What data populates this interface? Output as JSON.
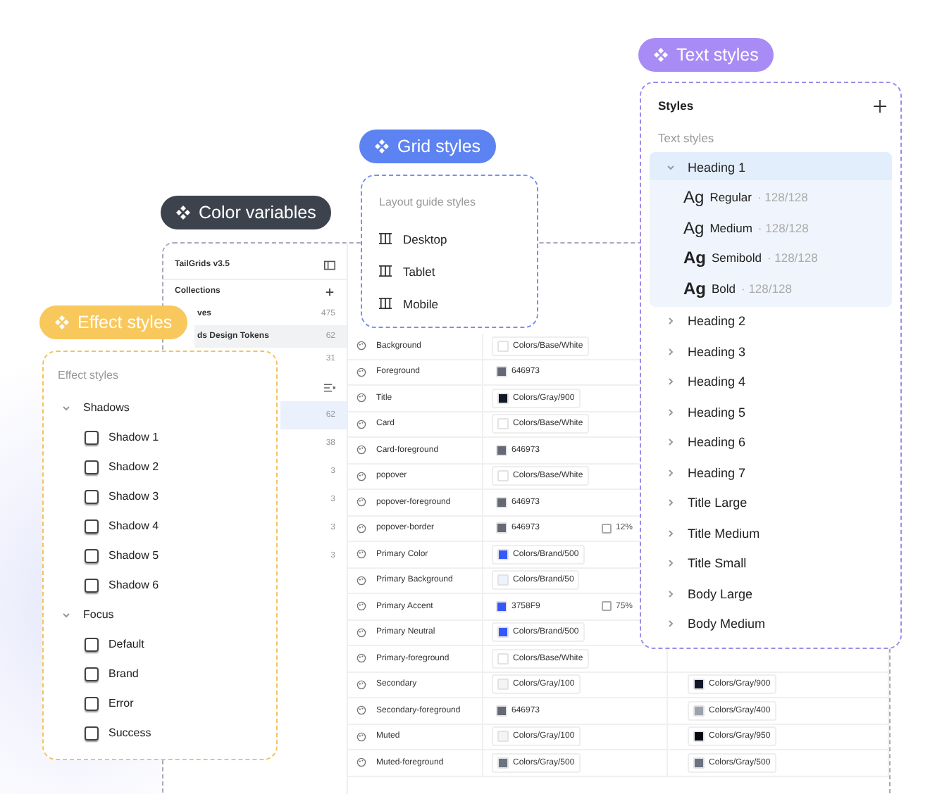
{
  "color_variables": {
    "badge": "Color variables",
    "sidebar": {
      "title": "TailGrids v3.5",
      "collections_label": "Collections",
      "collections": [
        {
          "name": "ves",
          "count": "475",
          "selected": false
        },
        {
          "name": "ds Design Tokens",
          "count": "62",
          "selected": true
        },
        {
          "count": "31",
          "selected": false
        }
      ],
      "groups": [
        {
          "count": "62",
          "selected": true
        },
        {
          "count": "38",
          "selected": false
        },
        {
          "count": "3",
          "selected": false
        },
        {
          "count": "3",
          "selected": false
        },
        {
          "count": "3",
          "selected": false
        },
        {
          "count": "3",
          "selected": false
        }
      ]
    },
    "rows": [
      {
        "name": "Background",
        "value": {
          "text": "Colors/Base/White",
          "kind": "alias",
          "color": "#ffffff"
        }
      },
      {
        "name": "Foreground",
        "value": {
          "text": "646973",
          "kind": "hex",
          "color": "#646973"
        }
      },
      {
        "name": "Title",
        "value": {
          "text": "Colors/Gray/900",
          "kind": "alias",
          "color": "#111827"
        }
      },
      {
        "name": "Card",
        "value": {
          "text": "Colors/Base/White",
          "kind": "alias",
          "color": "#ffffff"
        }
      },
      {
        "name": "Card-foreground",
        "value": {
          "text": "646973",
          "kind": "hex",
          "color": "#646973"
        }
      },
      {
        "name": "popover",
        "value": {
          "text": "Colors/Base/White",
          "kind": "alias",
          "color": "#ffffff"
        }
      },
      {
        "name": "popover-foreground",
        "value": {
          "text": "646973",
          "kind": "hex",
          "color": "#646973"
        }
      },
      {
        "name": "popover-border",
        "value": {
          "text": "646973",
          "kind": "hex",
          "color": "#646973"
        },
        "opacity": "12%"
      },
      {
        "name": "Primary Color",
        "value": {
          "text": "Colors/Brand/500",
          "kind": "alias",
          "color": "#3758f9"
        }
      },
      {
        "name": "Primary Background",
        "value": {
          "text": "Colors/Brand/50",
          "kind": "alias",
          "color": "#eef2ff"
        }
      },
      {
        "name": "Primary Accent",
        "value": {
          "text": "3758F9",
          "kind": "hex",
          "color": "#3758f9"
        },
        "opacity": "75%"
      },
      {
        "name": "Primary Neutral",
        "value": {
          "text": "Colors/Brand/500",
          "kind": "alias",
          "color": "#3758f9"
        }
      },
      {
        "name": "Primary-foreground",
        "value": {
          "text": "Colors/Base/White",
          "kind": "alias",
          "color": "#ffffff"
        }
      },
      {
        "name": "Secondary",
        "value": {
          "text": "Colors/Gray/100",
          "kind": "alias",
          "color": "#f3f4f6"
        },
        "mode_value": {
          "text": "Colors/Gray/900",
          "kind": "alias",
          "color": "#111827"
        }
      },
      {
        "name": "Secondary-foreground",
        "value": {
          "text": "646973",
          "kind": "hex",
          "color": "#646973"
        },
        "mode_value": {
          "text": "Colors/Gray/400",
          "kind": "alias",
          "color": "#9ca3af"
        }
      },
      {
        "name": "Muted",
        "value": {
          "text": "Colors/Gray/100",
          "kind": "alias",
          "color": "#f3f4f6"
        },
        "mode_value": {
          "text": "Colors/Gray/950",
          "kind": "alias",
          "color": "#030712"
        }
      },
      {
        "name": "Muted-foreground",
        "value": {
          "text": "Colors/Gray/500",
          "kind": "alias",
          "color": "#6b7280"
        },
        "mode_value": {
          "text": "Colors/Gray/500",
          "kind": "alias",
          "color": "#6b7280"
        }
      }
    ]
  },
  "effect_styles": {
    "badge": "Effect styles",
    "label": "Effect styles",
    "groups": [
      {
        "name": "Shadows",
        "expanded": true,
        "items": [
          "Shadow 1",
          "Shadow 2",
          "Shadow 3",
          "Shadow 4",
          "Shadow 5",
          "Shadow 6"
        ]
      },
      {
        "name": "Focus",
        "expanded": true,
        "items": [
          "Default",
          "Brand",
          "Error",
          "Success"
        ]
      }
    ]
  },
  "grid_styles": {
    "badge": "Grid styles",
    "label": "Layout guide styles",
    "items": [
      "Desktop",
      "Tablet",
      "Mobile"
    ]
  },
  "text_styles": {
    "badge": "Text styles",
    "title": "Styles",
    "label": "Text styles",
    "items": [
      {
        "name": "Heading 1",
        "expanded": true,
        "selected": true,
        "children": [
          {
            "sample": "Ag",
            "kind": "regular",
            "name": "Regular",
            "meta": "· 128/128"
          },
          {
            "sample": "Ag",
            "kind": "medium",
            "name": "Medium",
            "meta": "· 128/128"
          },
          {
            "sample": "Ag",
            "kind": "semibold",
            "name": "Semibold",
            "meta": "· 128/128"
          },
          {
            "sample": "Ag",
            "kind": "bold",
            "name": "Bold",
            "meta": "· 128/128"
          }
        ]
      },
      {
        "name": "Heading 2",
        "expanded": false,
        "selected": false
      },
      {
        "name": "Heading 3",
        "expanded": false,
        "selected": false
      },
      {
        "name": "Heading 4",
        "expanded": false,
        "selected": false
      },
      {
        "name": "Heading 5",
        "expanded": false,
        "selected": false
      },
      {
        "name": "Heading 6",
        "expanded": false,
        "selected": false
      },
      {
        "name": "Heading 7",
        "expanded": false,
        "selected": false
      },
      {
        "name": "Title Large",
        "expanded": false,
        "selected": false
      },
      {
        "name": "Title Medium",
        "expanded": false,
        "selected": false
      },
      {
        "name": "Title Small",
        "expanded": false,
        "selected": false
      },
      {
        "name": "Body Large",
        "expanded": false,
        "selected": false
      },
      {
        "name": "Body Medium",
        "expanded": false,
        "selected": false
      }
    ]
  }
}
